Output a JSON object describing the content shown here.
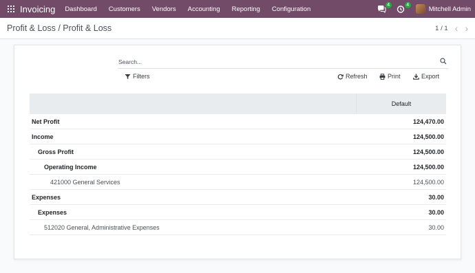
{
  "navbar": {
    "brand": "Invoicing",
    "menu": [
      "Dashboard",
      "Customers",
      "Vendors",
      "Accounting",
      "Reporting",
      "Configuration"
    ],
    "messages_count": "4",
    "activities_count": "4",
    "user": "Mitchell Admin",
    "accent": "#714b67"
  },
  "control_panel": {
    "breadcrumb": "Profit & Loss / Profit & Loss",
    "pager": "1 / 1"
  },
  "report": {
    "search_placeholder": "Search...",
    "filters_label": "Filters",
    "refresh_label": "Refresh",
    "print_label": "Print",
    "export_label": "Export",
    "column_header": "Default",
    "rows": [
      {
        "name": "Net Profit",
        "amount": "124,470.00",
        "level": 0
      },
      {
        "name": "Income",
        "amount": "124,500.00",
        "level": 0
      },
      {
        "name": "Gross Profit",
        "amount": "124,500.00",
        "level": 1
      },
      {
        "name": "Operating Income",
        "amount": "124,500.00",
        "level": 2
      },
      {
        "name": "421000 General Services",
        "amount": "124,500.00",
        "level": 3
      },
      {
        "name": "Expenses",
        "amount": "30.00",
        "level": 0
      },
      {
        "name": "Expenses",
        "amount": "30.00",
        "level": 1
      },
      {
        "name": "512020 General, Administrative Expenses",
        "amount": "30.00",
        "level": 3
      }
    ]
  }
}
